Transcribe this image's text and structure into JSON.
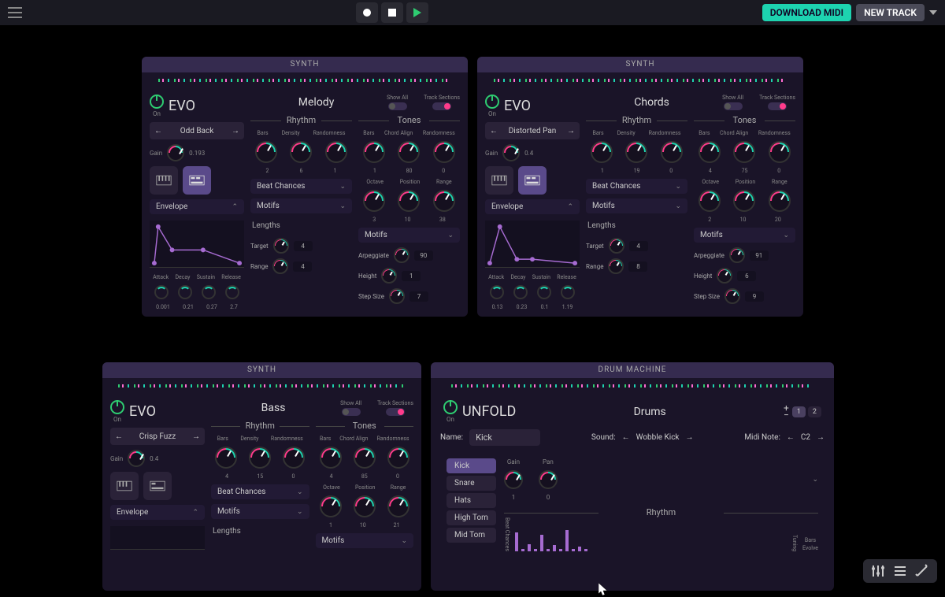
{
  "topbar": {
    "download": "DOWNLOAD MIDI",
    "new_track": "NEW TRACK"
  },
  "panels": [
    {
      "type": "SYNTH",
      "instrument": "EVO",
      "power_label": "On",
      "track": "Melody",
      "show_all": "Show All",
      "track_sections": "Track Sections",
      "preset": "Odd Back",
      "gain_label": "Gain",
      "gain_value": "0.193",
      "rhythm": {
        "title": "Rhythm",
        "labels": [
          "Bars",
          "Density",
          "Randomness"
        ],
        "values": [
          "2",
          "6",
          "1"
        ],
        "beat_chances": "Beat Chances",
        "motifs": "Motifs",
        "lengths": "Lengths",
        "target": {
          "label": "Target",
          "value": "4"
        },
        "range": {
          "label": "Range",
          "value": "4"
        }
      },
      "tones": {
        "title": "Tones",
        "labels": [
          "Bars",
          "Chord Align",
          "Randomness"
        ],
        "values": [
          "1",
          "80",
          "0"
        ],
        "opr": {
          "labels": [
            "Octave",
            "Position",
            "Range"
          ],
          "values": [
            "3",
            "10",
            "38"
          ]
        },
        "motifs": "Motifs",
        "arp": {
          "label": "Arpeggiate",
          "value": "90"
        },
        "height": {
          "label": "Height",
          "value": "1"
        },
        "step": {
          "label": "Step Size",
          "value": "7"
        }
      },
      "envelope": {
        "title": "Envelope",
        "labels": [
          "Attack",
          "Decay",
          "Sustain",
          "Release"
        ],
        "values": [
          "0.001",
          "0.21",
          "0.27",
          "2.7"
        ]
      }
    },
    {
      "type": "SYNTH",
      "instrument": "EVO",
      "power_label": "On",
      "track": "Chords",
      "show_all": "Show All",
      "track_sections": "Track Sections",
      "preset": "Distorted Pan",
      "gain_label": "Gain",
      "gain_value": "0.4",
      "rhythm": {
        "title": "Rhythm",
        "labels": [
          "Bars",
          "Density",
          "Randomness"
        ],
        "values": [
          "1",
          "19",
          "0"
        ],
        "beat_chances": "Beat Chances",
        "motifs": "Motifs",
        "lengths": "Lengths",
        "target": {
          "label": "Target",
          "value": "4"
        },
        "range": {
          "label": "Range",
          "value": "8"
        }
      },
      "tones": {
        "title": "Tones",
        "labels": [
          "Bars",
          "Chord Align",
          "Randomness"
        ],
        "values": [
          "4",
          "75",
          "0"
        ],
        "opr": {
          "labels": [
            "Octave",
            "Position",
            "Range"
          ],
          "values": [
            "2",
            "10",
            "20"
          ]
        },
        "motifs": "Motifs",
        "arp": {
          "label": "Arpeggiate",
          "value": "91"
        },
        "height": {
          "label": "Height",
          "value": "6"
        },
        "step": {
          "label": "Step Size",
          "value": "9"
        }
      },
      "envelope": {
        "title": "Envelope",
        "labels": [
          "Attack",
          "Decay",
          "Sustain",
          "Release"
        ],
        "values": [
          "0.13",
          "0.23",
          "0.1",
          "1.19"
        ]
      }
    },
    {
      "type": "SYNTH",
      "instrument": "EVO",
      "power_label": "On",
      "track": "Bass",
      "show_all": "Show All",
      "track_sections": "Track Sections",
      "preset": "Crisp Fuzz",
      "gain_label": "Gain",
      "gain_value": "0.4",
      "rhythm": {
        "title": "Rhythm",
        "labels": [
          "Bars",
          "Density",
          "Randomness"
        ],
        "values": [
          "4",
          "15",
          "0"
        ],
        "beat_chances": "Beat Chances",
        "motifs": "Motifs",
        "lengths": "Lengths"
      },
      "tones": {
        "title": "Tones",
        "labels": [
          "Bars",
          "Chord Align",
          "Randomness"
        ],
        "values": [
          "4",
          "85",
          "0"
        ],
        "opr": {
          "labels": [
            "Octave",
            "Position",
            "Range"
          ],
          "values": [
            "1",
            "10",
            "21"
          ]
        },
        "motifs": "Motifs"
      },
      "envelope": {
        "title": "Envelope"
      }
    }
  ],
  "drums": {
    "type": "DRUM MACHINE",
    "instrument": "UNFOLD",
    "power_label": "On",
    "track": "Drums",
    "zoom": [
      "1",
      "2"
    ],
    "name_label": "Name:",
    "name_value": "Kick",
    "sound_label": "Sound:",
    "sound_value": "Wobble Kick",
    "midi_label": "Midi Note:",
    "midi_value": "C2",
    "tabs": [
      "Kick",
      "Snare",
      "Hats",
      "High Tom",
      "Mid Tom"
    ],
    "gain_label": "Gain",
    "pan_label": "Pan",
    "gain_value": "1",
    "pan_value": "0",
    "rhythm_title": "Rhythm",
    "beat_label": "Beat Chances",
    "tuning_label": "Tuning",
    "bars_label": "Bars",
    "evolve_label": "Evolve"
  }
}
